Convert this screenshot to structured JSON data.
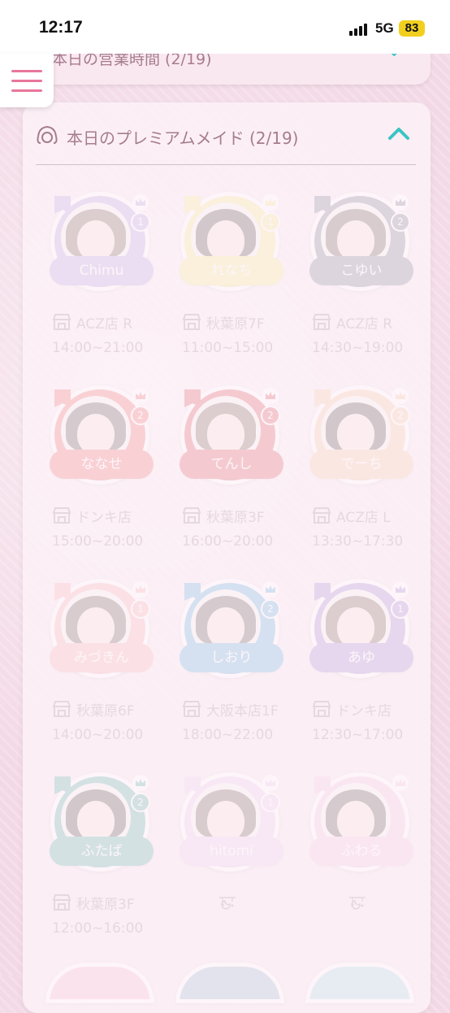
{
  "status_bar": {
    "time": "12:17",
    "network": "5G",
    "battery": "83"
  },
  "hours_section": {
    "title": "本日の営業時間 (2/19)"
  },
  "premium_section": {
    "title": "本日のプレミアムメイド (2/19)",
    "collapse_icon": "chevron-up-icon"
  },
  "colors": {
    "accent_teal": "#3cc4c4",
    "menu_pink": "#e8769b",
    "text_mauve": "#a67c8e"
  },
  "maids": [
    {
      "name": "Chimu",
      "rank": "1",
      "store": "ACZ店 R",
      "time": "14:00~21:00",
      "theme": "#a78bdc"
    },
    {
      "name": "れなち",
      "rank": "1",
      "store": "秋葉原7F",
      "time": "11:00~15:00",
      "theme": "#f0e36a"
    },
    {
      "name": "こゆい",
      "rank": "2",
      "store": "ACZ店 R",
      "time": "14:30~19:00",
      "theme": "#5d5f75"
    },
    {
      "name": "ななせ",
      "rank": "2",
      "store": "ドンキ店",
      "time": "15:00~20:00",
      "theme": "#ec4a4a"
    },
    {
      "name": "てんし",
      "rank": "2",
      "store": "秋葉原3F",
      "time": "16:00~20:00",
      "theme": "#cf2a33"
    },
    {
      "name": "でーち",
      "rank": "2",
      "store": "ACZ店 L",
      "time": "13:30~17:30",
      "theme": "#f5b98c"
    },
    {
      "name": "みづきん",
      "rank": "1",
      "store": "秋葉原6F",
      "time": "14:00~20:00",
      "theme": "#f59a9a"
    },
    {
      "name": "しおり",
      "rank": "2",
      "store": "大阪本店1F",
      "time": "18:00~22:00",
      "theme": "#3a99d8"
    },
    {
      "name": "あゆ",
      "rank": "1",
      "store": "ドンキ店",
      "time": "12:30~17:00",
      "theme": "#8b6cc8"
    },
    {
      "name": "ふたば",
      "rank": "2",
      "store": "秋葉原3F",
      "time": "12:00~16:00",
      "theme": "#2f9a92"
    },
    {
      "name": "hitomi",
      "rank": "1",
      "store": "",
      "time": "",
      "theme": "#e3b8ec"
    },
    {
      "name": "ふわる",
      "rank": "",
      "store": "",
      "time": "",
      "theme": "#eeb4d6"
    }
  ]
}
